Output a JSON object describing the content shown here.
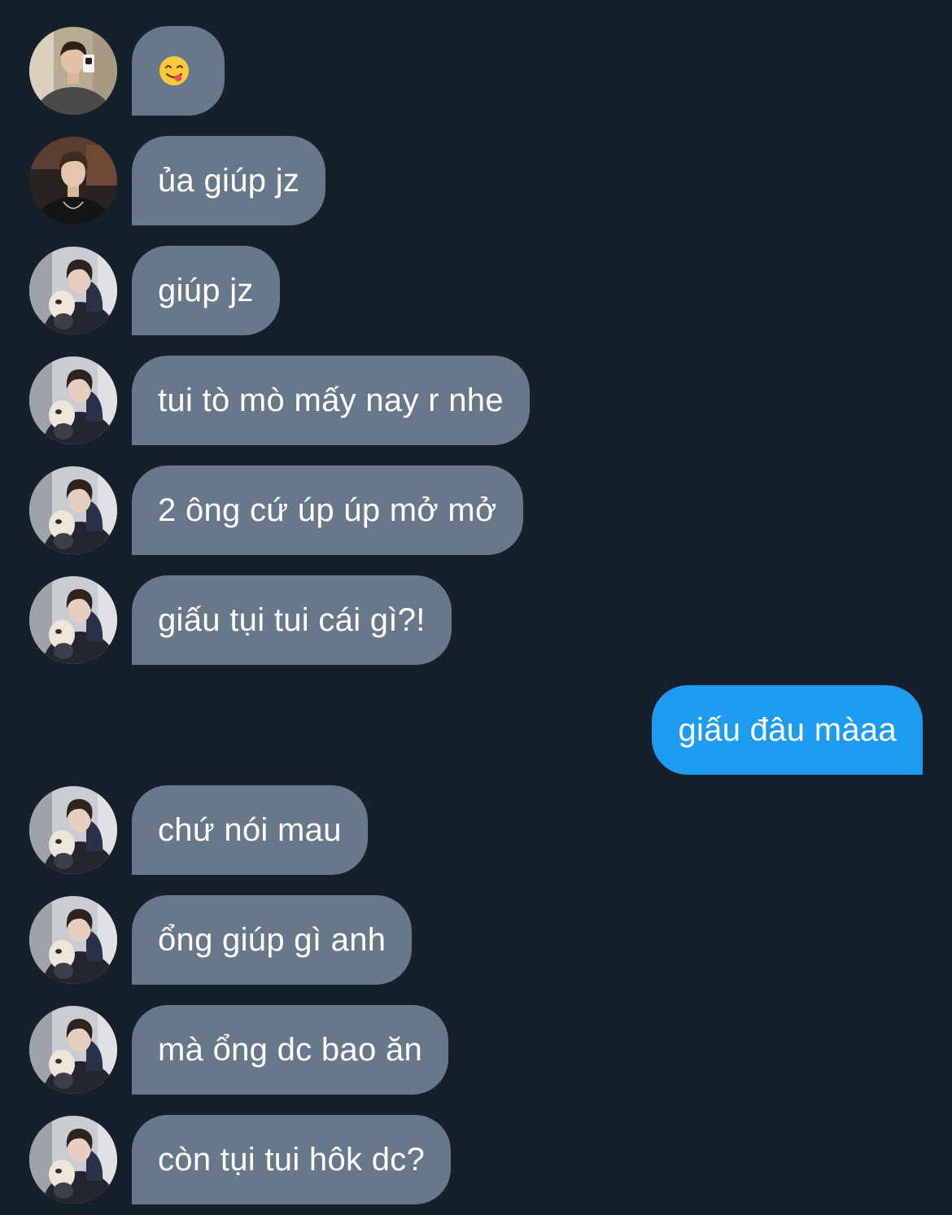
{
  "colors": {
    "background": "#16202b",
    "incoming_bubble": "#66788a",
    "outgoing_bubble": "#1d9bf0",
    "text": "#ffffff"
  },
  "messages": [
    {
      "direction": "incoming",
      "avatar": "avatar-mirror-selfie",
      "text": "",
      "emoji": "face-savoring-food-emoji"
    },
    {
      "direction": "incoming",
      "avatar": "avatar-dark-portrait",
      "text": "ủa giúp jz"
    },
    {
      "direction": "incoming",
      "avatar": "avatar-with-puppy",
      "text": "giúp jz"
    },
    {
      "direction": "incoming",
      "avatar": "avatar-with-puppy",
      "text": "tui tò mò mấy nay r nhe"
    },
    {
      "direction": "incoming",
      "avatar": "avatar-with-puppy",
      "text": "2 ông cứ úp úp mở mở"
    },
    {
      "direction": "incoming",
      "avatar": "avatar-with-puppy",
      "text": "giấu tụi tui cái gì?!"
    },
    {
      "direction": "outgoing",
      "text": "giấu đâu màaa"
    },
    {
      "direction": "incoming",
      "avatar": "avatar-with-puppy",
      "text": "chứ nói mau"
    },
    {
      "direction": "incoming",
      "avatar": "avatar-with-puppy",
      "text": "ổng giúp gì anh"
    },
    {
      "direction": "incoming",
      "avatar": "avatar-with-puppy",
      "text": "mà ổng dc bao ăn"
    },
    {
      "direction": "incoming",
      "avatar": "avatar-with-puppy",
      "text": "còn tụi tui hôk dc?"
    }
  ]
}
